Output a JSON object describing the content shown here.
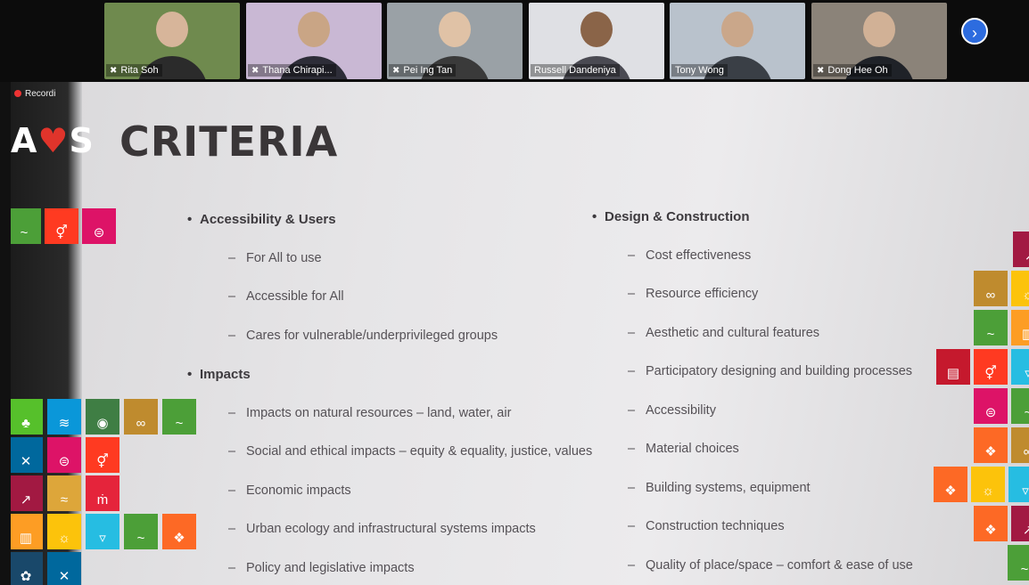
{
  "participants": [
    {
      "name": "Rita Soh",
      "bg": "#6f8a4e",
      "skin": "#d7b59a",
      "shirt": "#2b2b2b",
      "mic_icon": "mic-muted-icon"
    },
    {
      "name": "Thana Chirapi...",
      "bg": "#c9b8d4",
      "skin": "#c9a585",
      "shirt": "#2d2d38",
      "mic_icon": "mic-muted-icon"
    },
    {
      "name": "Pei Ing Tan",
      "bg": "#9aa1a6",
      "skin": "#e0c2a6",
      "shirt": "#3a3a3a",
      "mic_icon": "mic-muted-icon"
    },
    {
      "name": "Russell Dandeniya",
      "bg": "#dfe0e4",
      "skin": "#8a6448",
      "shirt": "#4a4a52",
      "mic_icon": ""
    },
    {
      "name": "Tony Wong",
      "bg": "#b9c2cc",
      "skin": "#caa78a",
      "shirt": "#3a3f46",
      "mic_icon": ""
    },
    {
      "name": "Dong Hee Oh",
      "bg": "#8b8379",
      "skin": "#d1b196",
      "shirt": "#1f2228",
      "mic_icon": "mic-muted-icon"
    }
  ],
  "next_icon": "chevron-right-icon",
  "recording_label": "Recordi",
  "brand": {
    "left": "A",
    "heart": "♥",
    "right": "S"
  },
  "slide": {
    "title": "CRITERIA",
    "left_col": [
      {
        "kind": "h",
        "text": "Accessibility & Users"
      },
      {
        "kind": "s",
        "text": "For All to use"
      },
      {
        "kind": "s",
        "text": "Accessible for All"
      },
      {
        "kind": "s",
        "text": "Cares for vulnerable/underprivileged groups"
      },
      {
        "kind": "h",
        "text": "Impacts"
      },
      {
        "kind": "s",
        "text": "Impacts on natural resources – land, water, air"
      },
      {
        "kind": "s",
        "text": "Social and ethical impacts – equity & equality, justice, values"
      },
      {
        "kind": "s",
        "text": "Economic impacts"
      },
      {
        "kind": "s",
        "text": "Urban ecology and infrastructural systems impacts"
      },
      {
        "kind": "s",
        "text": "Policy and legislative impacts"
      }
    ],
    "right_col": [
      {
        "kind": "h",
        "text": "Design & Construction"
      },
      {
        "kind": "s",
        "text": "Cost effectiveness"
      },
      {
        "kind": "s",
        "text": "Resource efficiency"
      },
      {
        "kind": "s",
        "text": "Aesthetic and cultural features"
      },
      {
        "kind": "s",
        "text": "Participatory designing and building processes"
      },
      {
        "kind": "s",
        "text": "Accessibility"
      },
      {
        "kind": "s",
        "text": "Material choices"
      },
      {
        "kind": "s",
        "text": "Building systems, equipment"
      },
      {
        "kind": "s",
        "text": "Construction techniques"
      },
      {
        "kind": "s",
        "text": "Quality of place/space – comfort & ease of use"
      }
    ]
  },
  "sdg_colors": {
    "1": "#e5243b",
    "2": "#dda63a",
    "3": "#4c9f38",
    "4": "#c5192d",
    "5": "#ff3a21",
    "6": "#26bde2",
    "7": "#fcc30b",
    "8": "#a21942",
    "9": "#fd6925",
    "10": "#dd1367",
    "11": "#fd9d24",
    "12": "#bf8b2e",
    "13": "#3f7e44",
    "14": "#0a97d9",
    "15": "#56c02b",
    "16": "#00689d",
    "17": "#19486a"
  },
  "sdg_left_top": [
    "3",
    "5",
    "10"
  ],
  "sdg_left_bottom": [
    [
      "15",
      "14",
      "13",
      "12",
      "3"
    ],
    [
      "16",
      "10",
      "5"
    ],
    [
      "8",
      "2",
      "1"
    ],
    [
      "11",
      "7",
      "6",
      "3",
      "9"
    ],
    [
      "17",
      "16"
    ]
  ],
  "sdg_right": [
    [
      "8"
    ],
    [
      "12",
      "7"
    ],
    [
      "3",
      "11"
    ],
    [
      "4",
      "5",
      "6"
    ],
    [
      "10",
      "3"
    ],
    [
      "9",
      "12"
    ],
    [
      "9",
      "7",
      "6"
    ],
    [
      "9",
      "8"
    ],
    [
      "3"
    ]
  ]
}
